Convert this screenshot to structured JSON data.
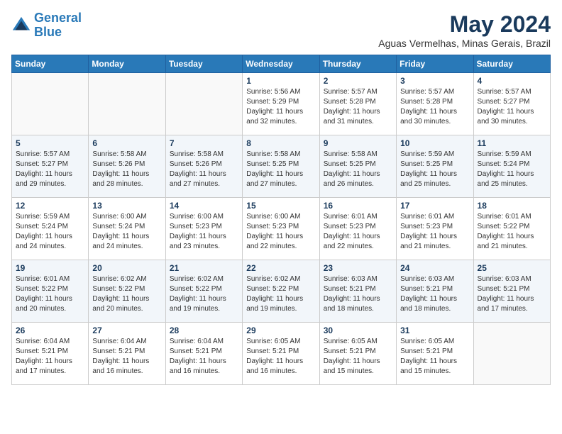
{
  "header": {
    "logo_line1": "General",
    "logo_line2": "Blue",
    "month": "May 2024",
    "location": "Aguas Vermelhas, Minas Gerais, Brazil"
  },
  "days_of_week": [
    "Sunday",
    "Monday",
    "Tuesday",
    "Wednesday",
    "Thursday",
    "Friday",
    "Saturday"
  ],
  "weeks": [
    [
      {
        "day": "",
        "info": ""
      },
      {
        "day": "",
        "info": ""
      },
      {
        "day": "",
        "info": ""
      },
      {
        "day": "1",
        "info": "Sunrise: 5:56 AM\nSunset: 5:29 PM\nDaylight: 11 hours\nand 32 minutes."
      },
      {
        "day": "2",
        "info": "Sunrise: 5:57 AM\nSunset: 5:28 PM\nDaylight: 11 hours\nand 31 minutes."
      },
      {
        "day": "3",
        "info": "Sunrise: 5:57 AM\nSunset: 5:28 PM\nDaylight: 11 hours\nand 30 minutes."
      },
      {
        "day": "4",
        "info": "Sunrise: 5:57 AM\nSunset: 5:27 PM\nDaylight: 11 hours\nand 30 minutes."
      }
    ],
    [
      {
        "day": "5",
        "info": "Sunrise: 5:57 AM\nSunset: 5:27 PM\nDaylight: 11 hours\nand 29 minutes."
      },
      {
        "day": "6",
        "info": "Sunrise: 5:58 AM\nSunset: 5:26 PM\nDaylight: 11 hours\nand 28 minutes."
      },
      {
        "day": "7",
        "info": "Sunrise: 5:58 AM\nSunset: 5:26 PM\nDaylight: 11 hours\nand 27 minutes."
      },
      {
        "day": "8",
        "info": "Sunrise: 5:58 AM\nSunset: 5:25 PM\nDaylight: 11 hours\nand 27 minutes."
      },
      {
        "day": "9",
        "info": "Sunrise: 5:58 AM\nSunset: 5:25 PM\nDaylight: 11 hours\nand 26 minutes."
      },
      {
        "day": "10",
        "info": "Sunrise: 5:59 AM\nSunset: 5:25 PM\nDaylight: 11 hours\nand 25 minutes."
      },
      {
        "day": "11",
        "info": "Sunrise: 5:59 AM\nSunset: 5:24 PM\nDaylight: 11 hours\nand 25 minutes."
      }
    ],
    [
      {
        "day": "12",
        "info": "Sunrise: 5:59 AM\nSunset: 5:24 PM\nDaylight: 11 hours\nand 24 minutes."
      },
      {
        "day": "13",
        "info": "Sunrise: 6:00 AM\nSunset: 5:24 PM\nDaylight: 11 hours\nand 24 minutes."
      },
      {
        "day": "14",
        "info": "Sunrise: 6:00 AM\nSunset: 5:23 PM\nDaylight: 11 hours\nand 23 minutes."
      },
      {
        "day": "15",
        "info": "Sunrise: 6:00 AM\nSunset: 5:23 PM\nDaylight: 11 hours\nand 22 minutes."
      },
      {
        "day": "16",
        "info": "Sunrise: 6:01 AM\nSunset: 5:23 PM\nDaylight: 11 hours\nand 22 minutes."
      },
      {
        "day": "17",
        "info": "Sunrise: 6:01 AM\nSunset: 5:23 PM\nDaylight: 11 hours\nand 21 minutes."
      },
      {
        "day": "18",
        "info": "Sunrise: 6:01 AM\nSunset: 5:22 PM\nDaylight: 11 hours\nand 21 minutes."
      }
    ],
    [
      {
        "day": "19",
        "info": "Sunrise: 6:01 AM\nSunset: 5:22 PM\nDaylight: 11 hours\nand 20 minutes."
      },
      {
        "day": "20",
        "info": "Sunrise: 6:02 AM\nSunset: 5:22 PM\nDaylight: 11 hours\nand 20 minutes."
      },
      {
        "day": "21",
        "info": "Sunrise: 6:02 AM\nSunset: 5:22 PM\nDaylight: 11 hours\nand 19 minutes."
      },
      {
        "day": "22",
        "info": "Sunrise: 6:02 AM\nSunset: 5:22 PM\nDaylight: 11 hours\nand 19 minutes."
      },
      {
        "day": "23",
        "info": "Sunrise: 6:03 AM\nSunset: 5:21 PM\nDaylight: 11 hours\nand 18 minutes."
      },
      {
        "day": "24",
        "info": "Sunrise: 6:03 AM\nSunset: 5:21 PM\nDaylight: 11 hours\nand 18 minutes."
      },
      {
        "day": "25",
        "info": "Sunrise: 6:03 AM\nSunset: 5:21 PM\nDaylight: 11 hours\nand 17 minutes."
      }
    ],
    [
      {
        "day": "26",
        "info": "Sunrise: 6:04 AM\nSunset: 5:21 PM\nDaylight: 11 hours\nand 17 minutes."
      },
      {
        "day": "27",
        "info": "Sunrise: 6:04 AM\nSunset: 5:21 PM\nDaylight: 11 hours\nand 16 minutes."
      },
      {
        "day": "28",
        "info": "Sunrise: 6:04 AM\nSunset: 5:21 PM\nDaylight: 11 hours\nand 16 minutes."
      },
      {
        "day": "29",
        "info": "Sunrise: 6:05 AM\nSunset: 5:21 PM\nDaylight: 11 hours\nand 16 minutes."
      },
      {
        "day": "30",
        "info": "Sunrise: 6:05 AM\nSunset: 5:21 PM\nDaylight: 11 hours\nand 15 minutes."
      },
      {
        "day": "31",
        "info": "Sunrise: 6:05 AM\nSunset: 5:21 PM\nDaylight: 11 hours\nand 15 minutes."
      },
      {
        "day": "",
        "info": ""
      }
    ]
  ]
}
